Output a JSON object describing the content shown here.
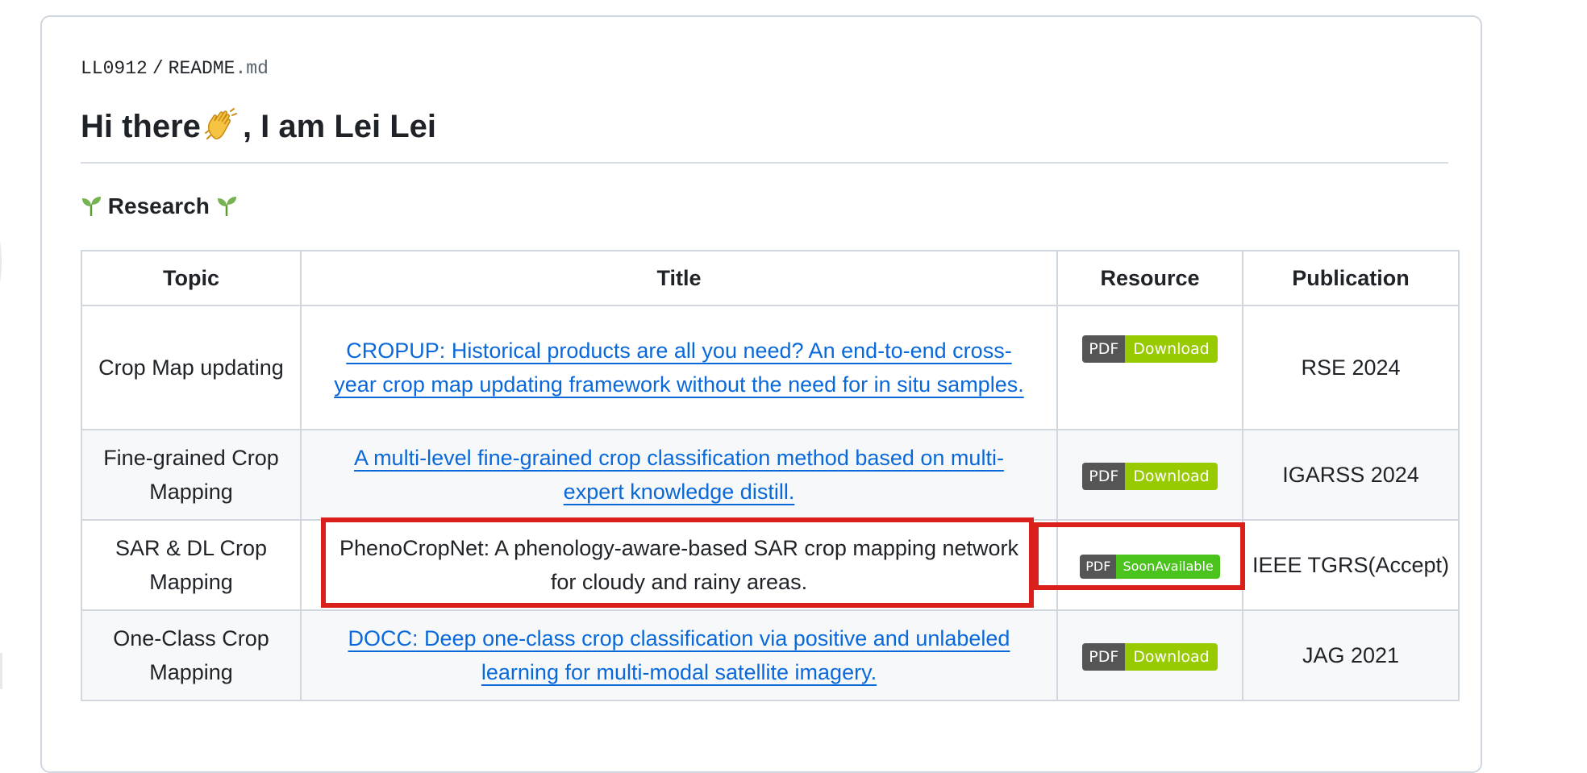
{
  "breadcrumb": {
    "user": "LL0912",
    "separator": "/",
    "file_name": "README",
    "file_ext": ".md"
  },
  "heading": {
    "before_emoji": "Hi there",
    "after_emoji": ", I am Lei Lei",
    "emoji_icon": "waving-hand-icon"
  },
  "research": {
    "label": "Research",
    "icon": "seedling-icon"
  },
  "table": {
    "headers": [
      "Topic",
      "Title",
      "Resource",
      "Publication"
    ],
    "rows": [
      {
        "topic": "Crop Map updating",
        "title": "CROPUP: Historical products are all you need? An end-to-end cross-year crop map updating framework without the need for in situ samples.",
        "title_is_link": true,
        "badge_left": "PDF",
        "badge_right": "Download",
        "publication": "RSE 2024"
      },
      {
        "topic": "Fine-grained Crop Mapping",
        "title": "A multi-level fine-grained crop classification method based on multi-expert knowledge distill.",
        "title_is_link": true,
        "badge_left": "PDF",
        "badge_right": "Download",
        "publication": "IGARSS 2024"
      },
      {
        "topic": "SAR & DL Crop Mapping",
        "title": "PhenoCropNet: A phenology-aware-based SAR crop mapping network for cloudy and rainy areas.",
        "title_is_link": false,
        "badge_left": "PDF",
        "badge_right": "SoonAvailable",
        "publication": "IEEE TGRS(Accept)"
      },
      {
        "topic": "One-Class Crop Mapping",
        "title": "DOCC: Deep one-class crop classification via positive and unlabeled learning for multi-modal satellite imagery.",
        "title_is_link": true,
        "badge_left": "PDF",
        "badge_right": "Download",
        "publication": "JAG 2021"
      }
    ]
  },
  "colors": {
    "link": "#0969da",
    "badge_download": "#97ca00",
    "badge_soon": "#4ac41c",
    "badge_label": "#555555",
    "highlight": "#d9201a"
  }
}
